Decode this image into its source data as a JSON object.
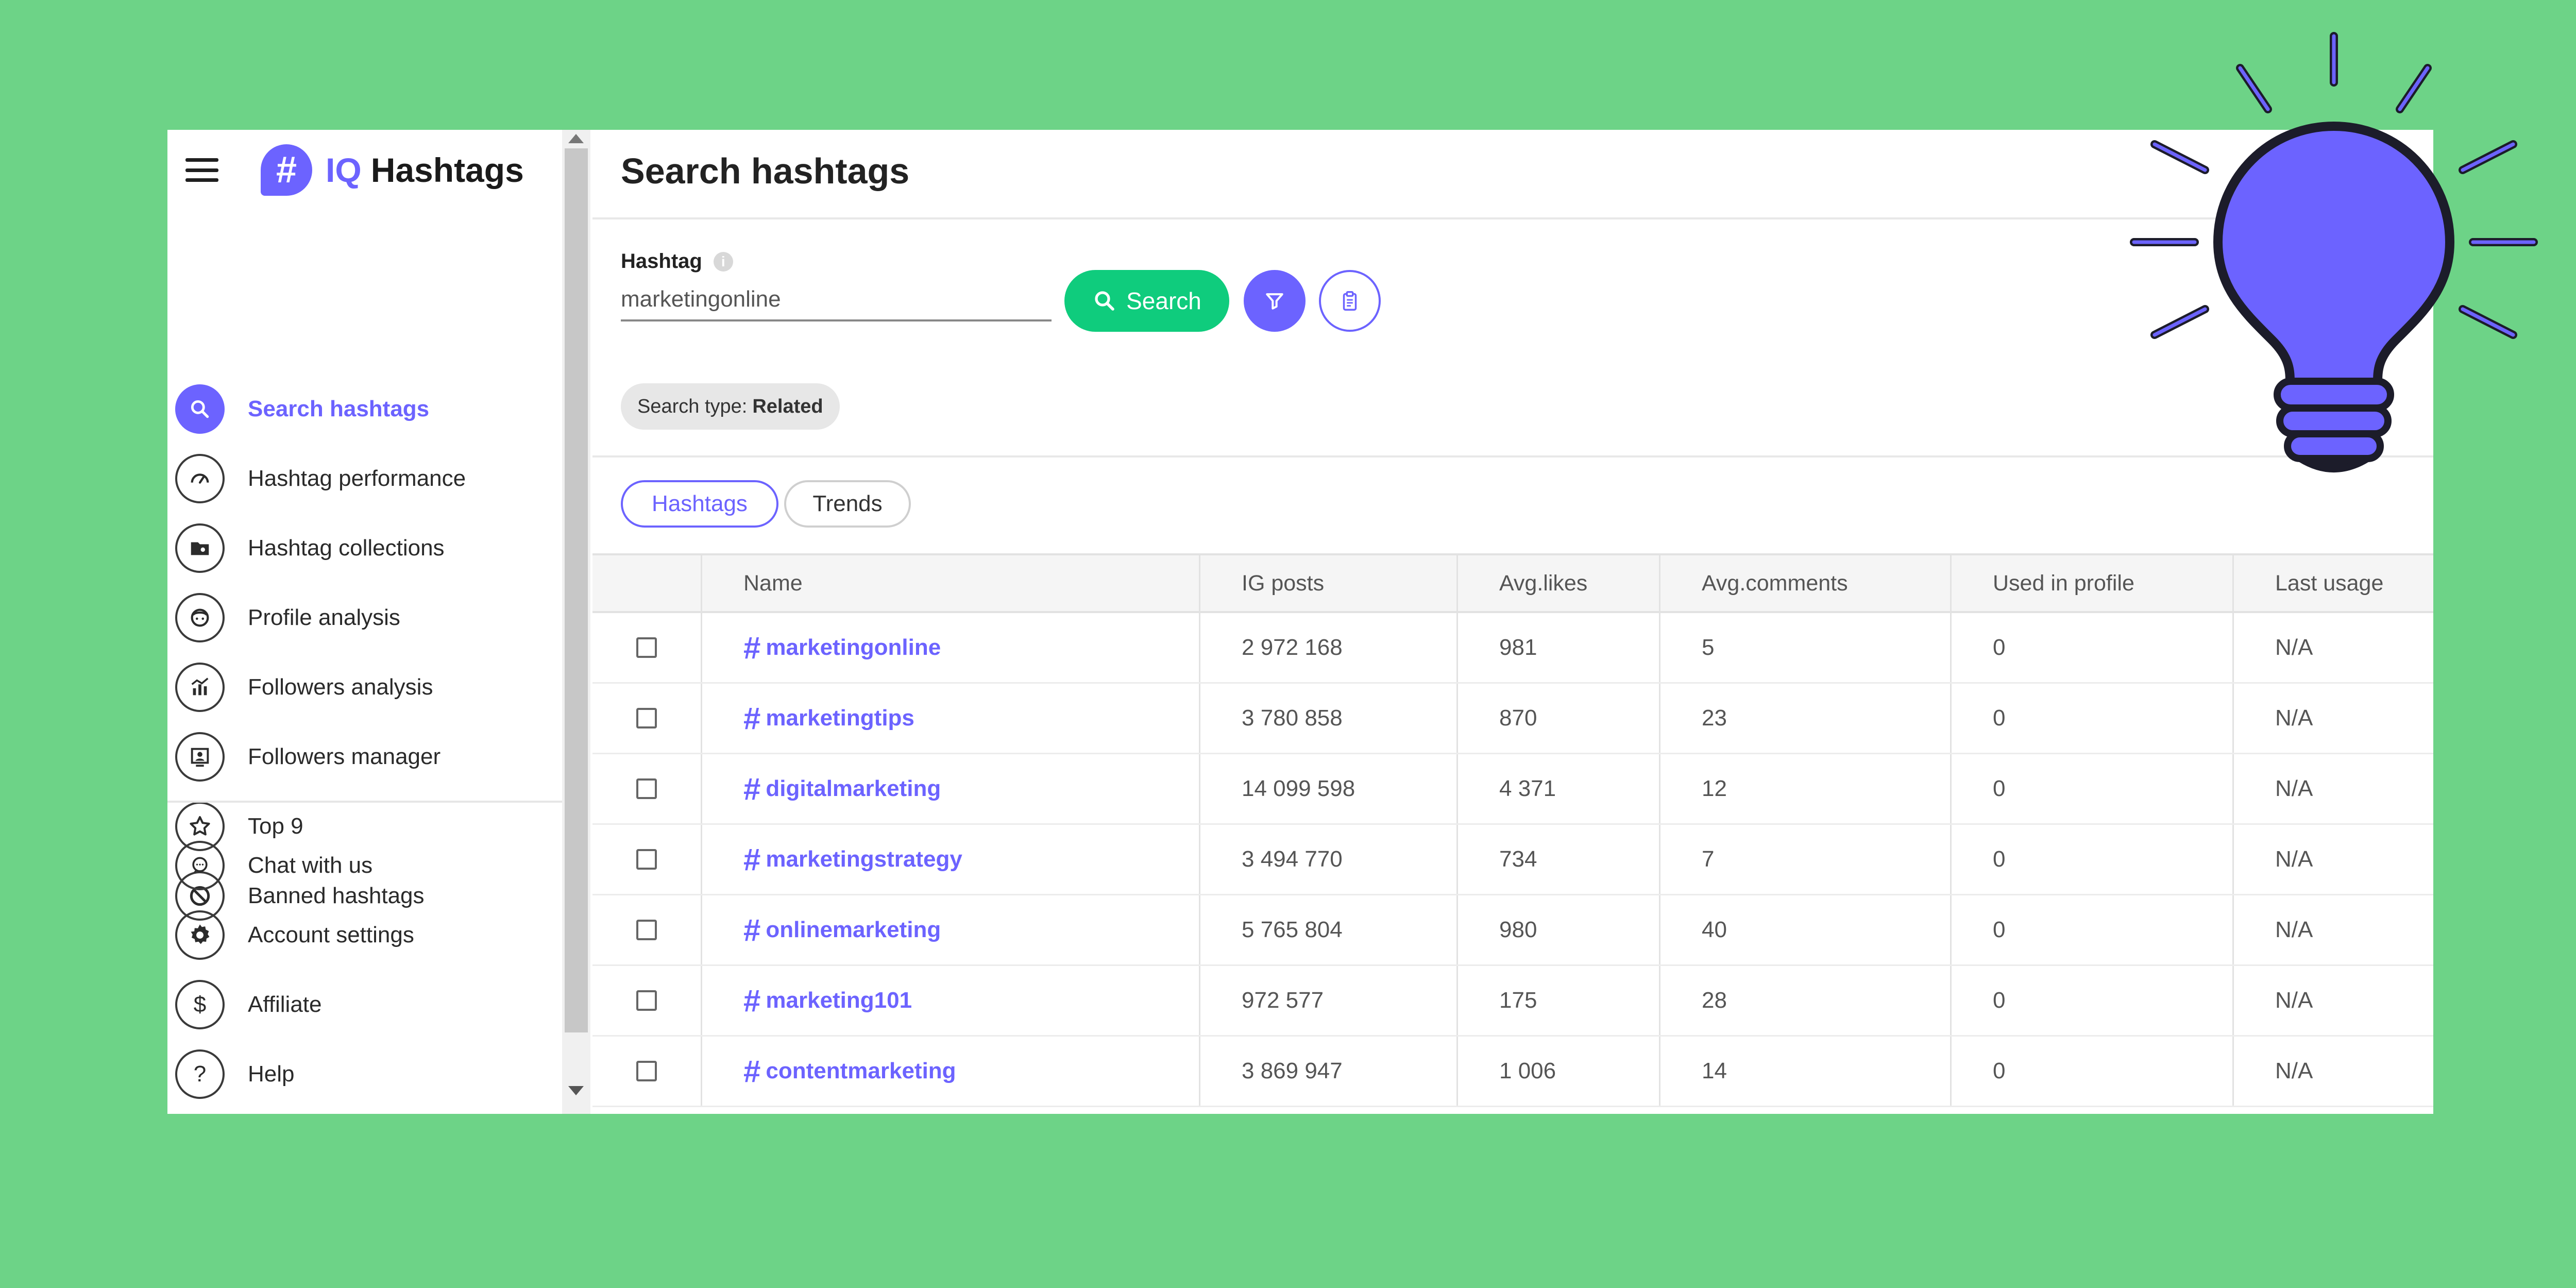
{
  "app": {
    "logo_badge": "#",
    "logo_iq": "IQ",
    "logo_text": "Hashtags"
  },
  "sidebar": {
    "items": [
      {
        "label": "Search hashtags",
        "icon": "search-icon",
        "active": true
      },
      {
        "label": "Hashtag performance",
        "icon": "gauge-icon"
      },
      {
        "label": "Hashtag collections",
        "icon": "folder-icon"
      },
      {
        "label": "Profile analysis",
        "icon": "face-icon"
      },
      {
        "label": "Followers analysis",
        "icon": "analytics-icon"
      },
      {
        "label": "Followers manager",
        "icon": "person-card-icon"
      },
      {
        "label": "Top 9",
        "icon": "star-icon"
      },
      {
        "label": "Banned hashtags",
        "icon": "ban-icon"
      }
    ],
    "bottom_items": [
      {
        "label": "Chat with us",
        "icon": "chat-icon"
      },
      {
        "label": "Account settings",
        "icon": "gear-icon"
      },
      {
        "label": "Affiliate",
        "icon": "dollar-icon"
      },
      {
        "label": "Help",
        "icon": "help-icon"
      }
    ]
  },
  "main": {
    "title": "Search hashtags",
    "hashtag_label": "Hashtag",
    "hashtag_value": "marketingonline",
    "search_button": "Search",
    "search_type_label": "Search type:",
    "search_type_value": "Related",
    "tabs": [
      {
        "label": "Hashtags",
        "active": true
      },
      {
        "label": "Trends",
        "active": false
      }
    ]
  },
  "table": {
    "headers": [
      "Name",
      "IG posts",
      "Avg.likes",
      "Avg.comments",
      "Used in profile",
      "Last usage"
    ],
    "rows": [
      {
        "name": "marketingonline",
        "posts": "2 972 168",
        "likes": "981",
        "comments": "5",
        "used": "0",
        "last": "N/A"
      },
      {
        "name": "marketingtips",
        "posts": "3 780 858",
        "likes": "870",
        "comments": "23",
        "used": "0",
        "last": "N/A"
      },
      {
        "name": "digitalmarketing",
        "posts": "14 099 598",
        "likes": "4 371",
        "comments": "12",
        "used": "0",
        "last": "N/A"
      },
      {
        "name": "marketingstrategy",
        "posts": "3 494 770",
        "likes": "734",
        "comments": "7",
        "used": "0",
        "last": "N/A"
      },
      {
        "name": "onlinemarketing",
        "posts": "5 765 804",
        "likes": "980",
        "comments": "40",
        "used": "0",
        "last": "N/A"
      },
      {
        "name": "marketing101",
        "posts": "972 577",
        "likes": "175",
        "comments": "28",
        "used": "0",
        "last": "N/A"
      },
      {
        "name": "contentmarketing",
        "posts": "3 869 947",
        "likes": "1 006",
        "comments": "14",
        "used": "0",
        "last": "N/A"
      }
    ]
  },
  "colors": {
    "background": "#6dd387",
    "accent": "#6c63ff",
    "search_button": "#0fcc7d"
  },
  "decoration": {
    "icon": "lightbulb-icon"
  }
}
